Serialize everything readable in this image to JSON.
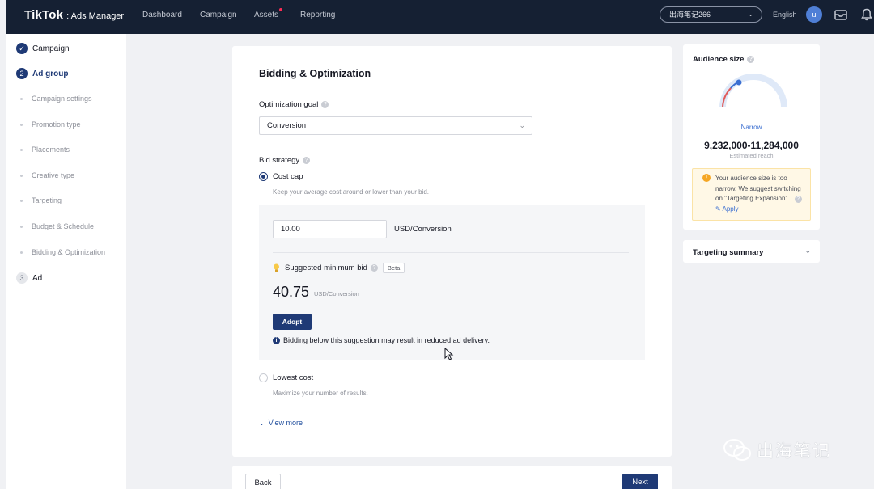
{
  "topbar": {
    "logo_main": "TikTok",
    "logo_sub": ": Ads Manager",
    "nav": [
      "Dashboard",
      "Campaign",
      "Assets",
      "Reporting"
    ],
    "account": "出海笔记266",
    "language": "English",
    "avatar_letter": "u"
  },
  "sidebar": {
    "steps": [
      {
        "badge": "✓",
        "label": "Campaign",
        "state": "done"
      },
      {
        "badge": "2",
        "label": "Ad group",
        "state": "active"
      },
      {
        "badge": "3",
        "label": "Ad",
        "state": "todo"
      }
    ],
    "substeps": [
      "Campaign settings",
      "Promotion type",
      "Placements",
      "Creative type",
      "Targeting",
      "Budget & Schedule",
      "Bidding & Optimization"
    ]
  },
  "main": {
    "title": "Bidding & Optimization",
    "optimization_goal_label": "Optimization goal",
    "optimization_goal_value": "Conversion",
    "bid_strategy_label": "Bid strategy",
    "cost_cap": {
      "label": "Cost cap",
      "hint": "Keep your average cost around or lower than your bid.",
      "selected": true
    },
    "bid_input_value": "10.00",
    "bid_unit": "USD/Conversion",
    "suggested_label": "Suggested minimum bid",
    "beta_label": "Beta",
    "suggested_value": "40.75",
    "suggested_unit": "USD/Conversion",
    "adopt_label": "Adopt",
    "info_text": "Bidding below this suggestion may result in reduced ad delivery.",
    "lowest_cost": {
      "label": "Lowest cost",
      "hint": "Maximize your number of results.",
      "selected": false
    },
    "view_more": "View more"
  },
  "footer": {
    "back_label": "Back",
    "next_label": "Next"
  },
  "audience": {
    "title": "Audience size",
    "level": "Narrow",
    "reach": "9,232,000-11,284,000",
    "reach_label": "Estimated reach",
    "warning": "Your audience size is too narrow. We suggest switching on \"Targeting Expansion\".",
    "apply_label": "Apply"
  },
  "targeting_summary": {
    "title": "Targeting summary"
  },
  "watermark": {
    "text": "出海笔记"
  },
  "colors": {
    "topbar": "#152033",
    "accent": "#1f3a76",
    "link": "#3b6fd1",
    "warning_bg": "#fff8e6",
    "warning_icon": "#f5a623"
  }
}
